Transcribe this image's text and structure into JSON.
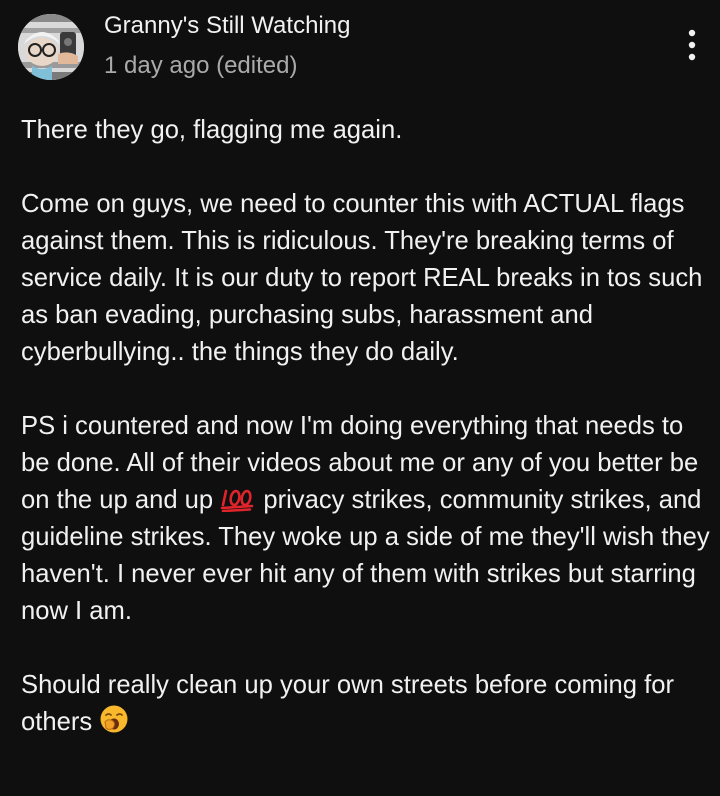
{
  "comment": {
    "author": "Granny's Still Watching",
    "timestamp": "1 day ago (edited)",
    "menu_icon": "more-vertical-icon",
    "avatar_icon": "granny-avatar-icon",
    "paragraphs": {
      "p1": "There they go, flagging me again.",
      "p2": "Come on guys, we need to counter this with ACTUAL flags against them. This is ridiculous. They're breaking terms of service daily. It is our duty to report REAL breaks in tos such as ban evading, purchasing subs, harassment and cyberbullying.. the things they do daily.",
      "p3a": "PS i countered and now I'm doing everything that needs to be done. All of their videos about me or any of you better be on the up and up ",
      "p3b": " privacy strikes, community strikes, and guideline strikes. They woke up a side of me they'll wish they haven't. I never ever hit any of them with strikes but starring now I am.",
      "p4": "Should really clean up your own streets before coming for others "
    },
    "emojis": {
      "hundred": "hundred-points-emoji",
      "yawn": "yawning-face-emoji"
    }
  },
  "colors": {
    "background": "#0f0f0f",
    "text_primary": "#f1f1f1",
    "text_secondary": "#aaaaaa",
    "hundred_red": "#e0242b",
    "emoji_yellow": "#f9b82c"
  }
}
